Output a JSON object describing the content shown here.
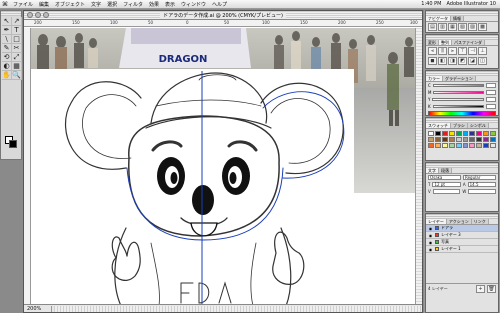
{
  "menubar": {
    "apple_icon": "",
    "items": [
      "ファイル",
      "編集",
      "オブジェクト",
      "文字",
      "選択",
      "フィルタ",
      "効果",
      "表示",
      "ウィンドウ",
      "ヘルプ"
    ],
    "clock": "1:40 PM",
    "app_name": "Adobe Illustrator 10"
  },
  "document": {
    "title": "ドアラのデータ作成.ai @ 200% (CMYK/プレビュー)",
    "zoom": "200%",
    "ruler_numbers": [
      "200",
      "150",
      "100",
      "50",
      "0",
      "50",
      "100",
      "150",
      "200",
      "250",
      "300"
    ],
    "photo_sign_text": "DRAGON"
  },
  "toolbox": {
    "tools": [
      "↖",
      "↗",
      "✒",
      "T",
      "\\",
      "□",
      "✎",
      "✂",
      "⟲",
      "⤢",
      "◐",
      "▦",
      "✋",
      "🔍"
    ]
  },
  "palettes": {
    "navigator": {
      "tabs": [
        "ナビゲータ",
        "情報"
      ]
    },
    "transform": {
      "tabs": [
        "変形",
        "整列",
        "パスファインダ"
      ]
    },
    "color": {
      "tabs": [
        "カラー",
        "グラデーション"
      ]
    },
    "swatches": {
      "tabs": [
        "スウォッチ",
        "ブラシ",
        "シンボル"
      ]
    },
    "character": {
      "tabs": [
        "文字",
        "段落"
      ],
      "font": "Osaka",
      "style": "Regular",
      "size": "12 pt",
      "leading": "14.5"
    },
    "layers": {
      "tabs": [
        "レイヤー",
        "アクション",
        "リンク"
      ],
      "items": [
        {
          "name": "ドアラ",
          "color": "#3366ff"
        },
        {
          "name": "レイヤー 3",
          "color": "#ff3333"
        },
        {
          "name": "写真",
          "color": "#33cc33"
        },
        {
          "name": "レイヤー 1",
          "color": "#ffcc00"
        }
      ],
      "count_label": "4 レイヤー"
    }
  },
  "colors": {
    "accent": "#3366ff",
    "sketch_stroke": "#333333",
    "guide_blue": "#1a3fb8"
  }
}
